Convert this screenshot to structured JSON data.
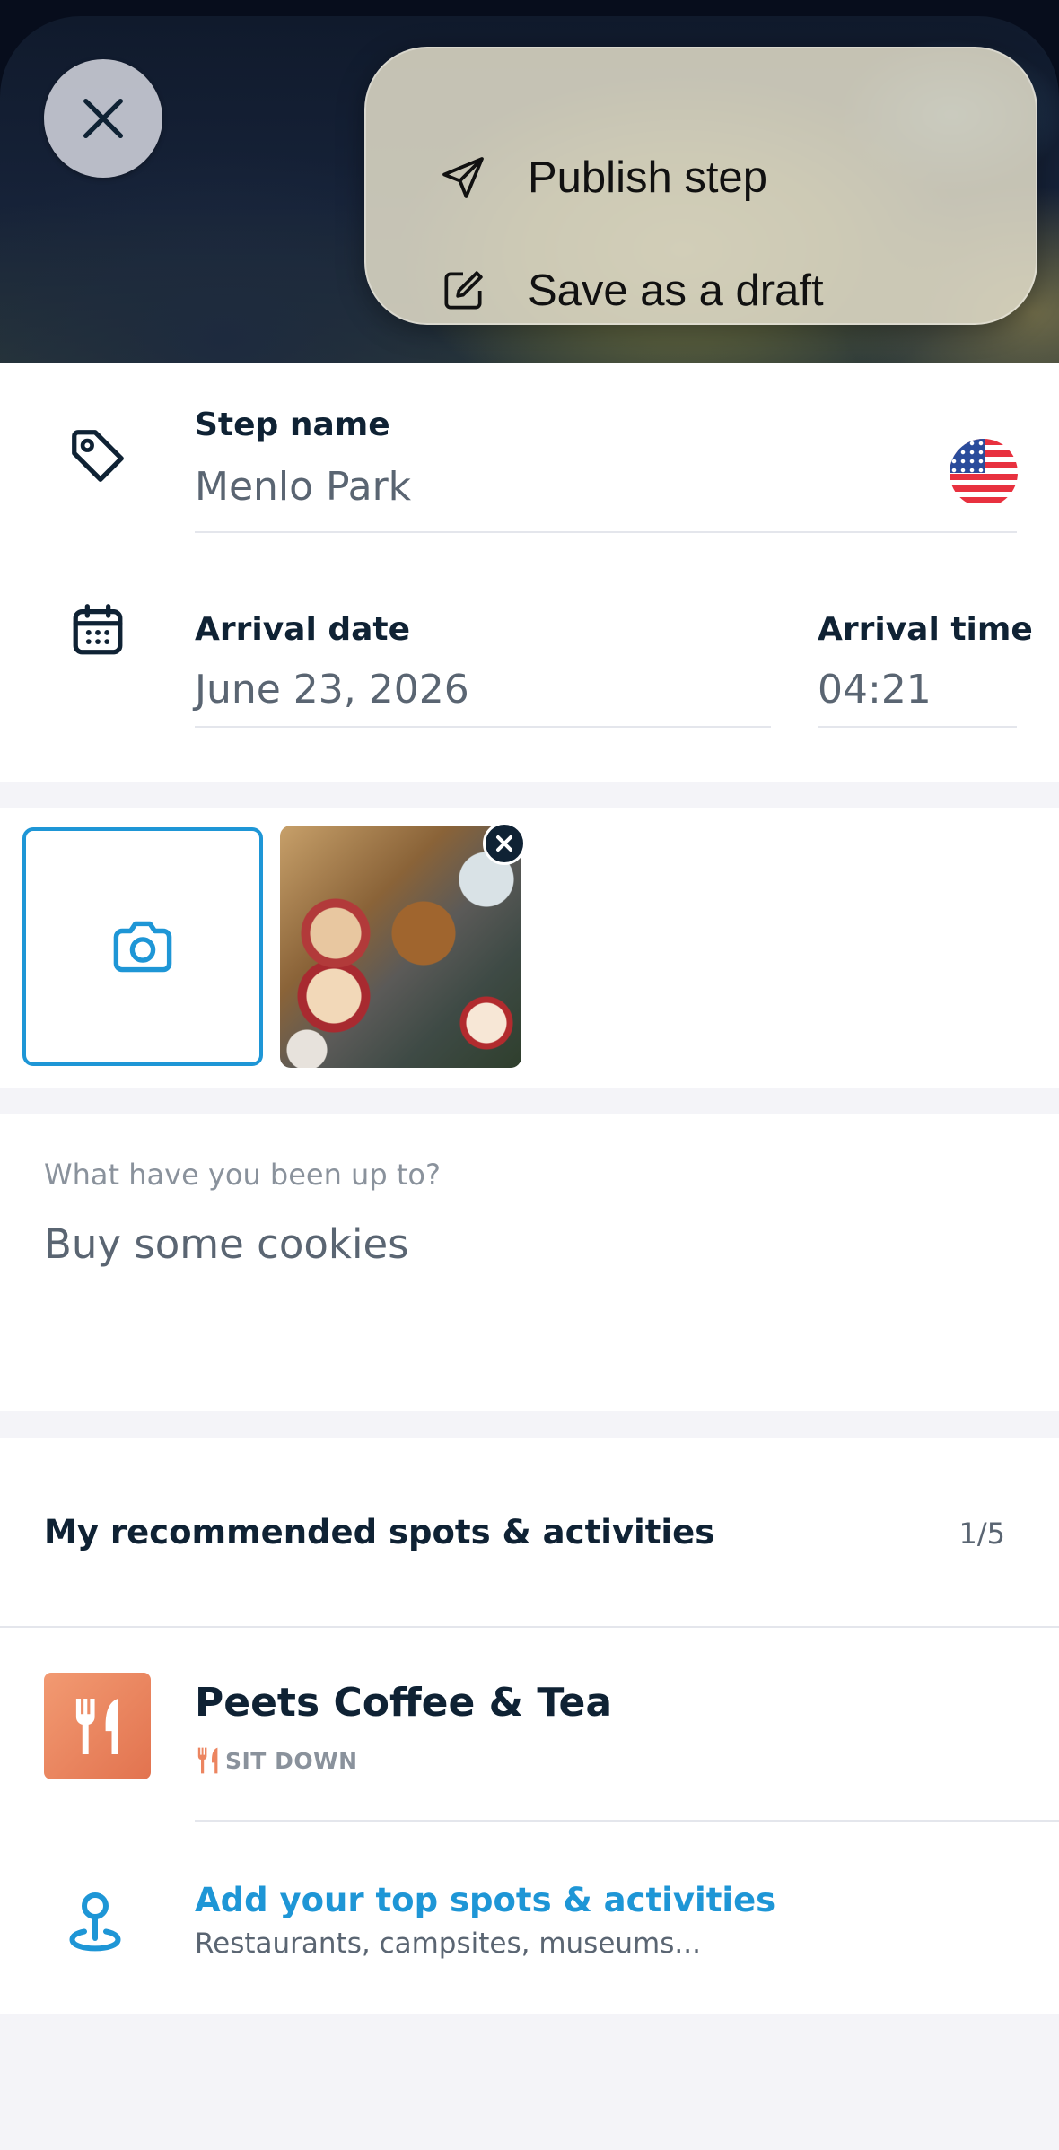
{
  "header": {
    "close_icon": "close-icon",
    "menu": {
      "items": [
        {
          "label": "Publish step",
          "icon": "send-icon"
        },
        {
          "label": "Save as a draft",
          "icon": "edit-icon"
        }
      ]
    }
  },
  "step": {
    "name_label": "Step name",
    "name_value": "Menlo Park",
    "country_flag": "us-flag-icon",
    "arrival_date_label": "Arrival date",
    "arrival_date_value": "June 23, 2026",
    "arrival_time_label": "Arrival time",
    "arrival_time_value": "04:21"
  },
  "photos": {
    "add_icon": "camera-icon",
    "items": [
      {
        "remove_icon": "close-icon"
      }
    ]
  },
  "story": {
    "prompt": "What have you been up to?",
    "text": "Buy some cookies"
  },
  "spots": {
    "title": "My recommended spots & activities",
    "count": "1/5",
    "items": [
      {
        "name": "Peets Coffee & Tea",
        "category": "SIT DOWN",
        "icon": "fork-knife-icon"
      }
    ],
    "add_title": "Add your top spots & activities",
    "add_subtitle": "Restaurants, campsites, museums..."
  },
  "colors": {
    "accent": "#1e96d6",
    "text_dark": "#0f2234",
    "text_muted": "#5a6572",
    "spot_orange": "#ec8560",
    "background": "#f4f4f8"
  }
}
